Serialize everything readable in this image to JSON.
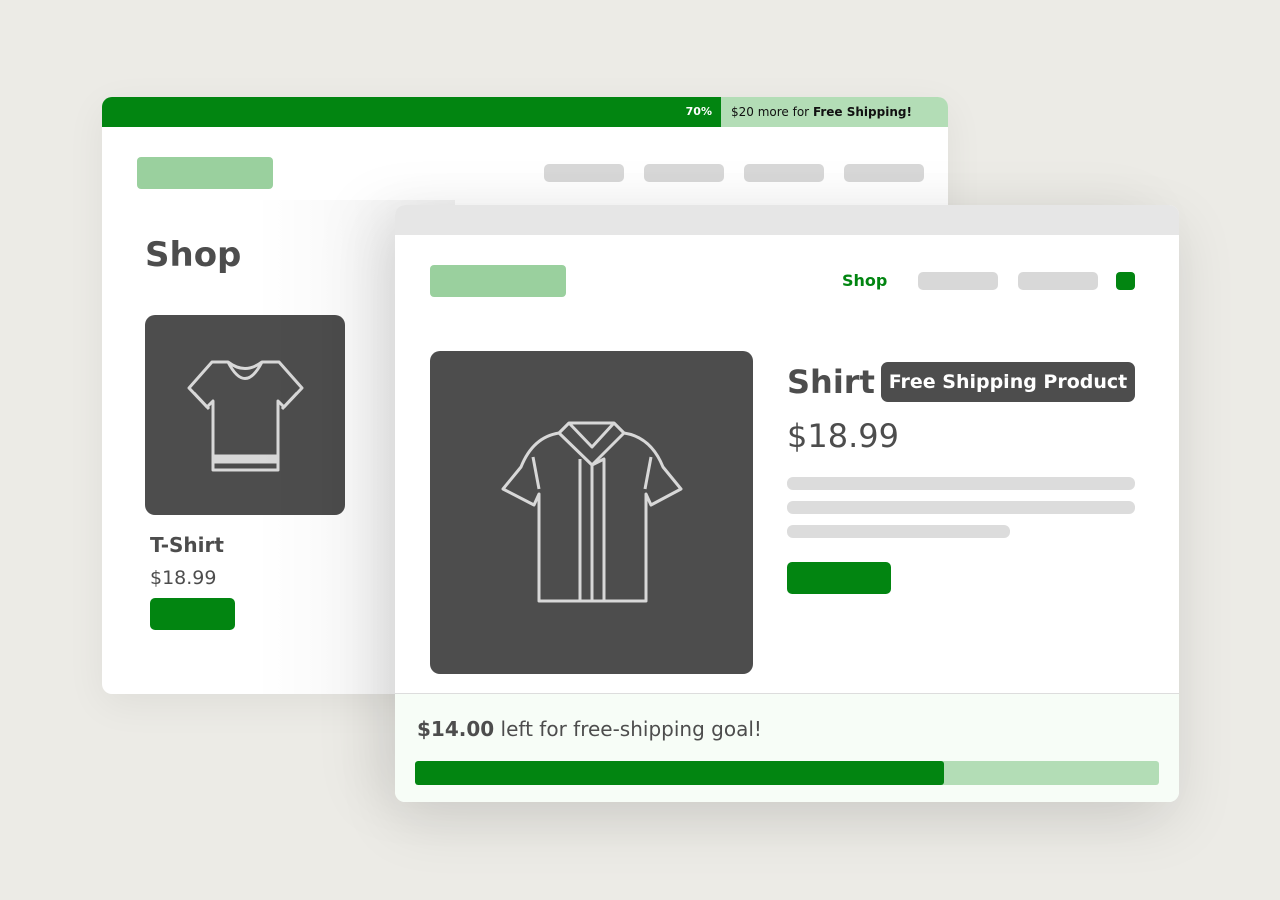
{
  "back_window": {
    "shipping_bar": {
      "percent_label": "70%",
      "progress": 0.7316,
      "message_prefix": "$20 more for ",
      "message_bold": "Free Shipping!"
    },
    "page_title": "Shop",
    "product_card": {
      "name": "T-Shirt",
      "price": "$18.99",
      "icon": "t-shirt-icon"
    }
  },
  "front_window": {
    "nav": {
      "shop_label": "Shop",
      "cart_icon": "cart-icon"
    },
    "product": {
      "name": "Shirt",
      "badge": "Free Shipping Product",
      "price": "$18.99",
      "icon": "shirt-icon"
    },
    "goal": {
      "amount": "$14.00",
      "message": " left for free-shipping goal!",
      "progress": 0.711
    }
  },
  "colors": {
    "background": "#ECEBE6",
    "accent_green": "#028511",
    "light_green": "#B3DDB6",
    "logo_green": "#9AD09E",
    "dark_gray": "#4D4D4D",
    "placeholder_gray": "#D8D8D8"
  }
}
